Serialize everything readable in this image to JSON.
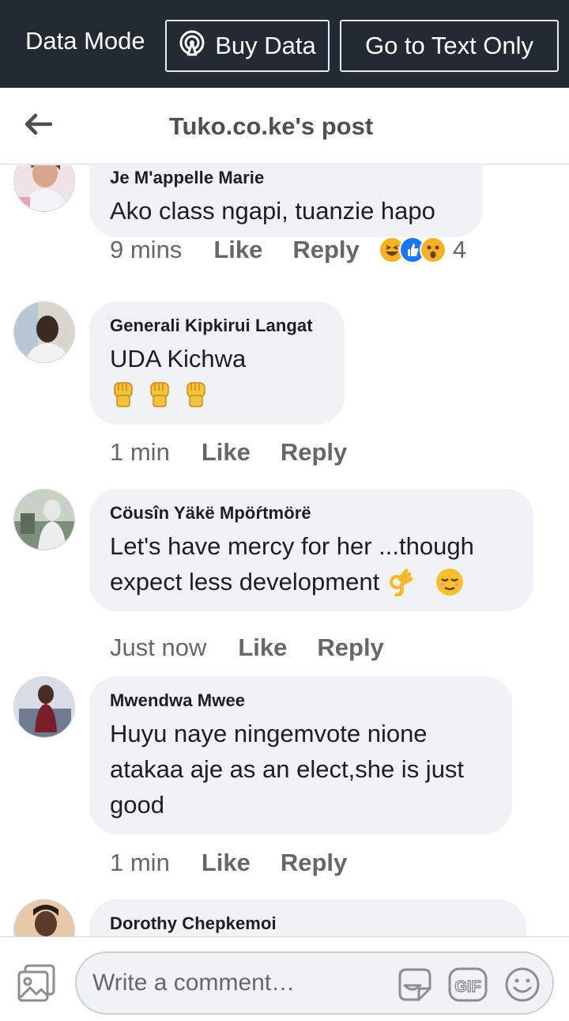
{
  "topbar": {
    "mode_label": "Data Mode",
    "buy_data_label": "Buy Data",
    "text_only_label": "Go to Text Only"
  },
  "header": {
    "title": "Tuko.co.ke's post"
  },
  "comments": [
    {
      "author": "Je M'appelle Marie",
      "text": "Ako class ngapi, tuanzie hapo",
      "time": "9 mins",
      "like_label": "Like",
      "reply_label": "Reply",
      "reaction_count": "4",
      "reactions": [
        "haha",
        "like",
        "wow"
      ]
    },
    {
      "author": "Generali Kipkirui Langat",
      "text": "UDA Kichwa",
      "emojis": [
        "raised-fist",
        "raised-fist",
        "raised-fist"
      ],
      "time": "1 min",
      "like_label": "Like",
      "reply_label": "Reply"
    },
    {
      "author": "Cöusîn Yäkë Mpöŕtmörë",
      "text_line1": "Let's  have mercy for her ...though",
      "text_line2": "expect less development",
      "emojis": [
        "ok-hand",
        "relieved-face"
      ],
      "time": "Just now",
      "like_label": "Like",
      "reply_label": "Reply"
    },
    {
      "author": "Mwendwa Mwee",
      "text_line1": "Huyu naye ningemvote nione",
      "text_line2": "atakaa aje as an elect,she is just",
      "text_line3": "good",
      "time": "1 min",
      "like_label": "Like",
      "reply_label": "Reply"
    },
    {
      "author": "Dorothy Chepkemoi"
    }
  ],
  "composer": {
    "placeholder": "Write a comment…",
    "gif_label": "GIF"
  },
  "colors": {
    "topbar_bg": "#242a33",
    "bubble_bg": "#f0f2f5",
    "secondary_text": "#65676b",
    "like_blue": "#1877f2"
  }
}
